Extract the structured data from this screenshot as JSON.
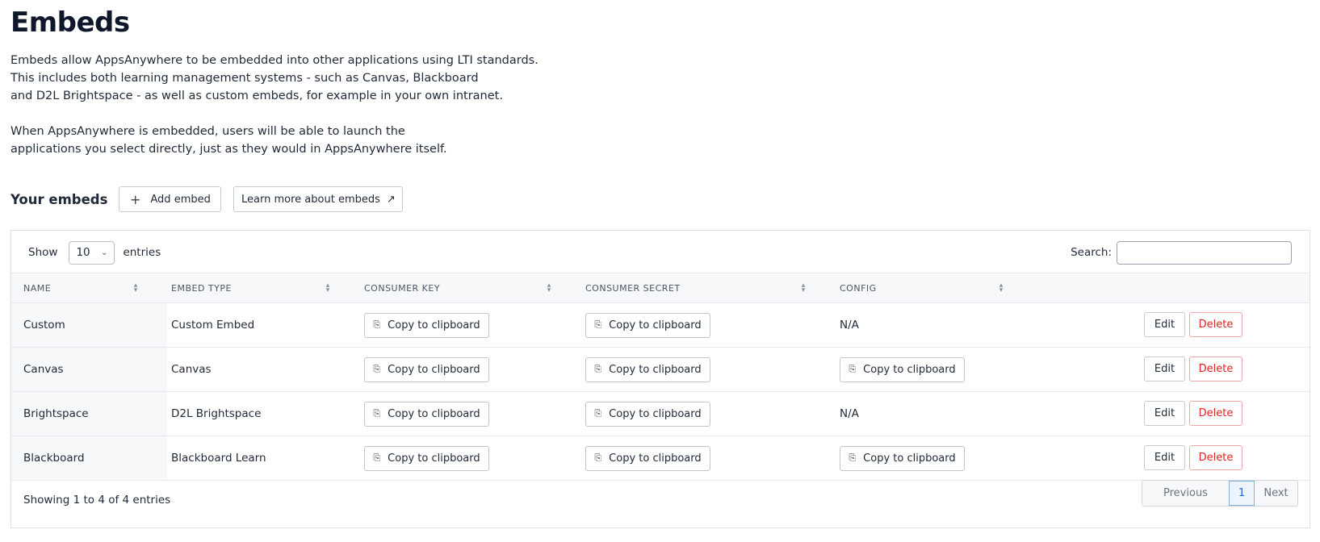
{
  "page": {
    "title": "Embeds",
    "intro_lines": [
      "Embeds allow AppsAnywhere to be embedded into other applications using LTI standards.",
      "This includes both learning management systems - such as Canvas, Blackboard",
      "and D2L Brightspace - as well as custom embeds, for example in your own intranet.",
      "When AppsAnywhere is embedded, users will be able to launch the",
      "applications you select directly, just as they would in AppsAnywhere itself."
    ]
  },
  "embeds_section": {
    "title": "Your embeds",
    "add_label": "Add embed",
    "learn_label": "Learn more about embeds"
  },
  "table": {
    "show_label": "Show",
    "entries_value": "10",
    "entries_label": "entries",
    "search_label": "Search:",
    "search_value": "",
    "columns": [
      "NAME",
      "EMBED TYPE",
      "CONSUMER KEY",
      "CONSUMER SECRET",
      "CONFIG"
    ],
    "copy_label": "Copy to clipboard",
    "na_label": "N/A",
    "edit_label": "Edit",
    "delete_label": "Delete",
    "rows": [
      {
        "name": "Custom",
        "type": "Custom Embed",
        "config": "N/A"
      },
      {
        "name": "Canvas",
        "type": "Canvas",
        "config": "Copy to clipboard"
      },
      {
        "name": "Brightspace",
        "type": "D2L Brightspace",
        "config": "N/A"
      },
      {
        "name": "Blackboard",
        "type": "Blackboard Learn",
        "config": "Copy to clipboard"
      }
    ],
    "info": "Showing 1 to 4 of 4 entries",
    "pager": {
      "previous": "Previous",
      "current": "1",
      "next": "Next"
    }
  },
  "icons": {
    "plus": "plus-icon",
    "external": "external-link-icon",
    "copy": "clipboard-icon",
    "sort": "sort-icon",
    "chevron": "chevron-down-icon"
  }
}
